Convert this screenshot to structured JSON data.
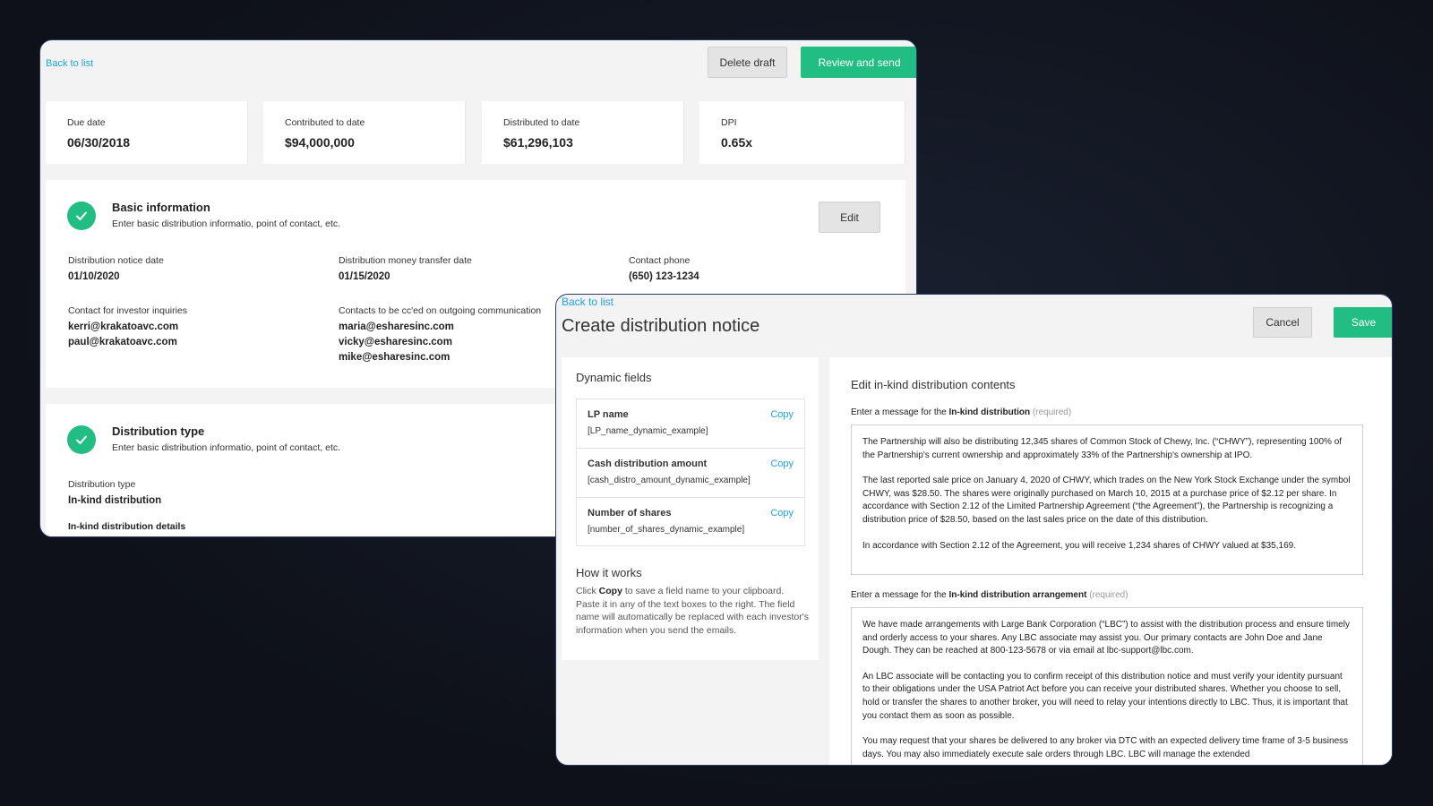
{
  "back_window": {
    "back_link": "Back to list",
    "delete_draft": "Delete draft",
    "review_send": "Review and send",
    "stats": [
      {
        "label": "Due date",
        "value": "06/30/2018"
      },
      {
        "label": "Contributed to date",
        "value": "$94,000,000"
      },
      {
        "label": "Distributed to date",
        "value": "$61,296,103"
      },
      {
        "label": "DPI",
        "value": "0.65x"
      }
    ],
    "basic": {
      "title": "Basic information",
      "subtitle": "Enter basic distribution informatio, point of contact, etc.",
      "edit": "Edit",
      "notice_date_label": "Distribution notice date",
      "notice_date": "01/10/2020",
      "transfer_date_label": "Distribution money transfer date",
      "transfer_date": "01/15/2020",
      "phone_label": "Contact phone",
      "phone": "(650) 123-1234",
      "inquiries_label": "Contact for investor inquiries",
      "inquiries": [
        "kerri@krakatoavc.com",
        "paul@krakatoavc.com"
      ],
      "cc_label": "Contacts to be cc'ed on outgoing communication",
      "cc": [
        "maria@esharesinc.com",
        "vicky@esharesinc.com",
        "mike@esharesinc.com"
      ]
    },
    "dist_type": {
      "title": "Distribution type",
      "subtitle": "Enter basic distribution informatio, point of contact, etc.",
      "type_label": "Distribution type",
      "type_value": "In-kind distribution",
      "details_label": "In-kind distribution details"
    }
  },
  "front_window": {
    "back_link": "Back to list",
    "title": "Create distribution notice",
    "cancel": "Cancel",
    "save": "Save",
    "dynamic": {
      "title": "Dynamic fields",
      "fields": [
        {
          "name": "LP name",
          "example": "[LP_name_dynamic_example]",
          "copy": "Copy"
        },
        {
          "name": "Cash distribution amount",
          "example": "[cash_distro_amount_dynamic_example]",
          "copy": "Copy"
        },
        {
          "name": "Number of shares",
          "example": "[number_of_shares_dynamic_example]",
          "copy": "Copy"
        }
      ],
      "how_title": "How it works",
      "how_pre": "Click ",
      "how_bold": "Copy",
      "how_post": " to save a field name to your clipboard. Paste it in any of the text boxes to the right. The field name will automatically be replaced with each investor's information when you send the emails."
    },
    "editor": {
      "title": "Edit in-kind distribution contents",
      "msg1_pre": "Enter a message for the ",
      "msg1_bold": "In-kind distribution",
      "msg1_req": " (required)",
      "msg1_paragraphs": [
        "The Partnership will also be distributing 12,345 shares of Common Stock of Chewy, Inc. (“CHWY”), representing 100% of the Partnership's current ownership and approximately 33% of the Partnership's ownership at IPO.",
        "The last reported sale price on January 4, 2020 of CHWY, which trades on the New York Stock Exchange under the symbol CHWY, was $28.50. The shares were originally purchased on March 10, 2015 at a purchase price of $2.12 per share. In accordance with Section 2.12 of the Limited Partnership Agreement (“the Agreement”), the Partnership is recognizing a distribution price of $28.50, based on the last sales price on the date of this distribution.",
        "In accordance with Section 2.12 of the Agreement, you will receive 1,234 shares of CHWY valued at $35,169."
      ],
      "msg2_pre": "Enter a message for the ",
      "msg2_bold": "In-kind distribution arrangement",
      "msg2_req": " (required)",
      "msg2_paragraphs": [
        "We have made arrangements with Large Bank Corporation (“LBC”) to assist with the distribution process and ensure timely and orderly access to your shares. Any LBC associate may assist you. Our primary contacts are John Doe and Jane Dough. They can be reached at 800-123-5678 or via email at lbc-support@lbc.com.",
        "An LBC associate will be contacting you to confirm receipt of this distribution notice and must verify your identity pursuant to their obligations under the USA Patriot Act before you can receive your distributed shares. Whether you choose to sell, hold or transfer the shares to another broker, you will need to relay your intentions directly to LBC. Thus, it is important that you contact them as soon as possible.",
        "You may request that your shares be delivered to any broker via DTC with an expected delivery time frame of 3-5 business days. You may also immediately execute sale orders through LBC. LBC will manage the extended"
      ]
    }
  }
}
